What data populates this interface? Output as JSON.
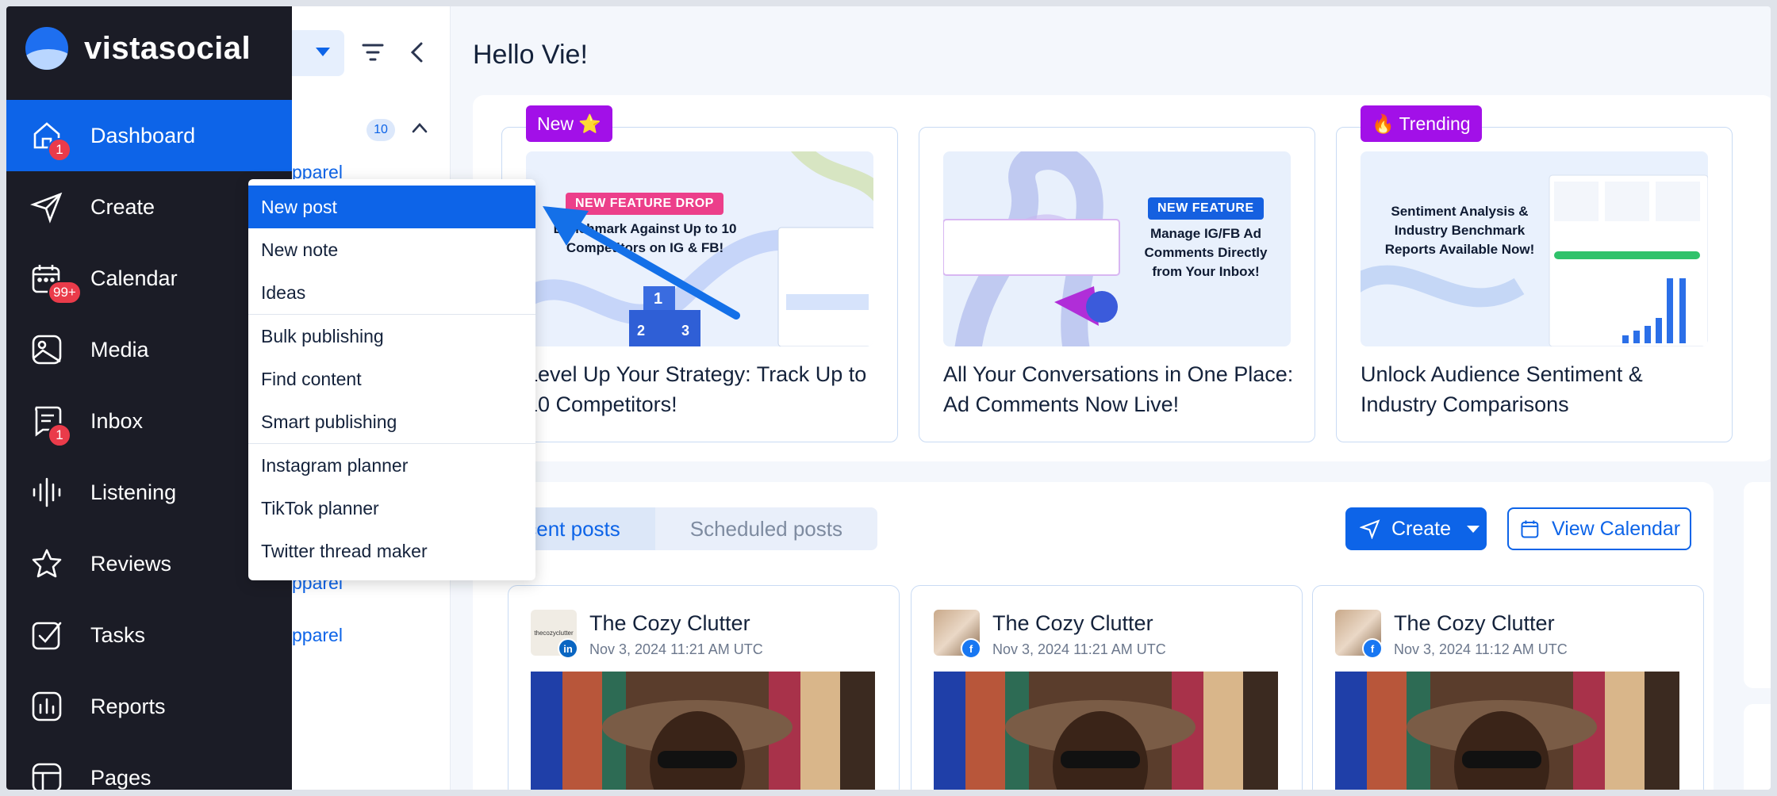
{
  "brand": {
    "name": "vistasocial"
  },
  "sidebar": {
    "items": [
      {
        "label": "Dashboard",
        "icon": "home-icon",
        "badge": "1",
        "active": true
      },
      {
        "label": "Create",
        "icon": "send-icon",
        "badge": ""
      },
      {
        "label": "Calendar",
        "icon": "calendar-icon",
        "badge": "99+"
      },
      {
        "label": "Media",
        "icon": "image-icon",
        "badge": ""
      },
      {
        "label": "Inbox",
        "icon": "inbox-icon",
        "badge": "1"
      },
      {
        "label": "Listening",
        "icon": "waveform-icon",
        "badge": ""
      },
      {
        "label": "Reviews",
        "icon": "star-icon",
        "badge": ""
      },
      {
        "label": "Tasks",
        "icon": "checkbox-icon",
        "badge": ""
      },
      {
        "label": "Reports",
        "icon": "bar-chart-icon",
        "badge": ""
      },
      {
        "label": "Pages",
        "icon": "layout-icon",
        "badge": ""
      }
    ]
  },
  "subcolumn": {
    "count": "10",
    "fragments": [
      "pparel",
      "pparel",
      "pparel"
    ]
  },
  "main": {
    "greeting": "Hello Vie!",
    "promos": [
      {
        "tag": "New ⭐",
        "image_badge": "NEW FEATURE DROP",
        "image_text": "Benchmark Against Up to 10 Competitors on IG & FB!",
        "title": "Level Up Your Strategy: Track Up to 10 Competitors!"
      },
      {
        "tag": "",
        "image_badge": "NEW FEATURE",
        "image_text": "Manage IG/FB Ad Comments Directly from Your Inbox!",
        "title": "All Your Conversations in One Place: Ad Comments Now Live!"
      },
      {
        "tag": "🔥 Trending",
        "image_badge": "",
        "image_text": "Sentiment Analysis & Industry Benchmark Reports Available Now!",
        "title": "Unlock Audience Sentiment & Industry Comparisons"
      }
    ],
    "tabs": [
      "Recent posts",
      "Scheduled posts"
    ],
    "create_label": "Create",
    "calendar_label": "View Calendar",
    "posts": [
      {
        "name": "The Cozy Clutter",
        "date": "Nov 3, 2024 11:21 AM UTC",
        "network": "linkedin",
        "avatar_text": "thecozyclutter"
      },
      {
        "name": "The Cozy Clutter",
        "date": "Nov 3, 2024 11:21 AM UTC",
        "network": "facebook",
        "avatar_text": ""
      },
      {
        "name": "The Cozy Clutter",
        "date": "Nov 3, 2024 11:12 AM UTC",
        "network": "facebook",
        "avatar_text": ""
      }
    ]
  },
  "menu": {
    "items": [
      "New post",
      "New note",
      "Ideas",
      "Bulk publishing",
      "Find content",
      "Smart publishing",
      "Instagram planner",
      "TikTok planner",
      "Twitter thread maker"
    ]
  },
  "colors": {
    "primary": "#0d64e8",
    "sidebar": "#1b1c26",
    "tag_purple": "#a210e8",
    "badge_red": "#ea3b4a"
  }
}
